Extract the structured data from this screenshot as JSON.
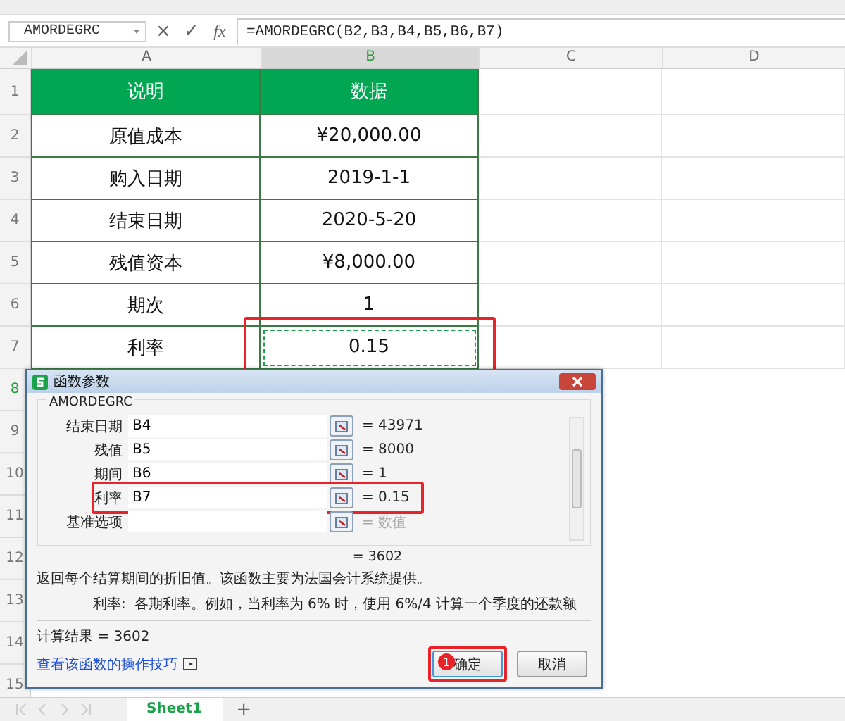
{
  "formula_bar": {
    "name_box": "AMORDEGRC",
    "cancel": "×",
    "confirm": "✓",
    "fx": "fx",
    "formula": "=AMORDEGRC(B2,B3,B4,B5,B6,B7)"
  },
  "columns": [
    {
      "label": "A",
      "selected": false
    },
    {
      "label": "B",
      "selected": true
    },
    {
      "label": "C",
      "selected": false
    },
    {
      "label": "D",
      "selected": false
    }
  ],
  "rows": [
    {
      "number": "1",
      "selected": false,
      "kind": "header",
      "a": "说明",
      "b": "数据",
      "b_selected": false,
      "b_highlighted": false
    },
    {
      "number": "2",
      "selected": false,
      "kind": "data",
      "a": "原值成本",
      "b": "¥20,000.00",
      "b_selected": false,
      "b_highlighted": false
    },
    {
      "number": "3",
      "selected": false,
      "kind": "data",
      "a": "购入日期",
      "b": "2019-1-1",
      "b_selected": false,
      "b_highlighted": false
    },
    {
      "number": "4",
      "selected": false,
      "kind": "data",
      "a": "结束日期",
      "b": "2020-5-20",
      "b_selected": false,
      "b_highlighted": false
    },
    {
      "number": "5",
      "selected": false,
      "kind": "data",
      "a": "残值资本",
      "b": "¥8,000.00",
      "b_selected": false,
      "b_highlighted": false
    },
    {
      "number": "6",
      "selected": false,
      "kind": "data",
      "a": "期次",
      "b": "1",
      "b_selected": false,
      "b_highlighted": false
    },
    {
      "number": "7",
      "selected": false,
      "kind": "data",
      "a": "利率",
      "b": "0.15",
      "b_selected": true,
      "b_highlighted": true
    }
  ],
  "empty_rows": [
    {
      "number": "8",
      "selected": true
    },
    {
      "number": "9",
      "selected": false
    },
    {
      "number": "10",
      "selected": false
    },
    {
      "number": "11",
      "selected": false
    },
    {
      "number": "12",
      "selected": false
    },
    {
      "number": "13",
      "selected": false
    },
    {
      "number": "14",
      "selected": false
    },
    {
      "number": "15",
      "selected": false
    }
  ],
  "dialog": {
    "title": "函数参数",
    "function_name": "AMORDEGRC",
    "params": [
      {
        "label": "结束日期",
        "value": "B4",
        "result": "= 43971",
        "empty": false,
        "highlighted": false
      },
      {
        "label": "残值",
        "value": "B5",
        "result": "= 8000",
        "empty": false,
        "highlighted": false
      },
      {
        "label": "期间",
        "value": "B6",
        "result": "= 1",
        "empty": false,
        "highlighted": false
      },
      {
        "label": "利率",
        "value": "B7",
        "result": "= 0.15",
        "empty": false,
        "highlighted": true
      },
      {
        "label": "基准选项",
        "result": "= 数值",
        "empty": true,
        "highlighted": false
      }
    ],
    "formula_result": "= 3602",
    "description": "返回每个结算期间的折旧值。该函数主要为法国会计系统提供。",
    "param_help_label": "利率:",
    "param_help": "各期利率。例如，当利率为 6% 时，使用 6%/4 计算一个季度的还款额",
    "calc_result": "计算结果 = 3602",
    "help_link": "查看该函数的操作技巧",
    "buttons": [
      {
        "label": "确定",
        "kind": "primary",
        "highlighted": true,
        "badge": "1"
      },
      {
        "label": "取消",
        "kind": "secondary",
        "highlighted": false
      }
    ]
  },
  "sheet_tabs": [
    {
      "label": "Sheet1",
      "selected": true
    }
  ],
  "add_sheet": "+"
}
